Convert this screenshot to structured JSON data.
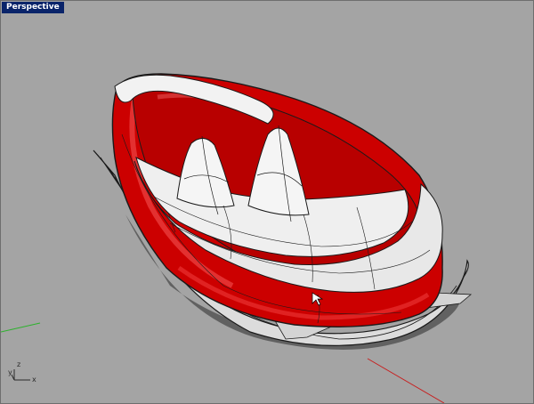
{
  "viewport": {
    "title": "Perspective",
    "projection": "perspective",
    "display_mode": "rendered",
    "background_color": "#a4a4a4",
    "title_background_color": "#0a246a"
  },
  "model": {
    "outer_surface_color": "#cc0000",
    "inner_surface_color": "#f2f2f2",
    "isocurve_color": "#1a1a1a"
  },
  "axes_indicator": {
    "z_label": "z",
    "y_label": "y",
    "x_label": "x"
  },
  "world_axes": {
    "x_axis_color": "#c81e1e",
    "y_axis_color": "#2db22d"
  }
}
